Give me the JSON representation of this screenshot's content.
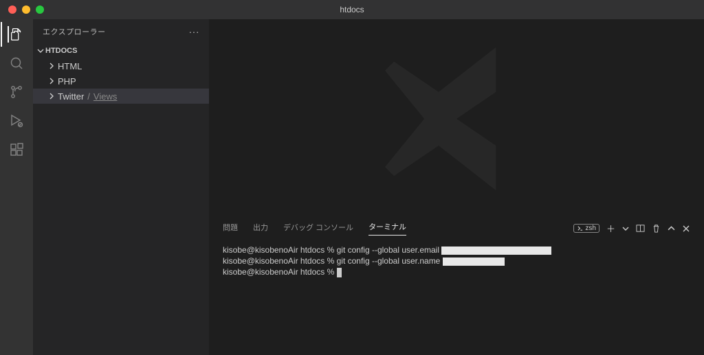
{
  "titlebar": {
    "title": "htdocs"
  },
  "sidebar": {
    "header": "エクスプローラー",
    "root": "HTDOCS",
    "items": [
      {
        "label": "HTML"
      },
      {
        "label": "PHP"
      },
      {
        "label": "Twitter",
        "subpath": "Views"
      }
    ]
  },
  "panel": {
    "tabs": {
      "problems": "問題",
      "output": "出力",
      "debug": "デバッグ コンソール",
      "terminal": "ターミナル"
    },
    "shell": "zsh",
    "terminal": {
      "lines": [
        {
          "prompt": "kisobe@kisobenoAir htdocs % ",
          "cmd": "git config --global user.email ",
          "redact": 160
        },
        {
          "prompt": "kisobe@kisobenoAir htdocs % ",
          "cmd": "git config --global user.name ",
          "redact": 90
        },
        {
          "prompt": "kisobe@kisobenoAir htdocs % ",
          "cmd": "",
          "cursor": true
        }
      ]
    }
  }
}
